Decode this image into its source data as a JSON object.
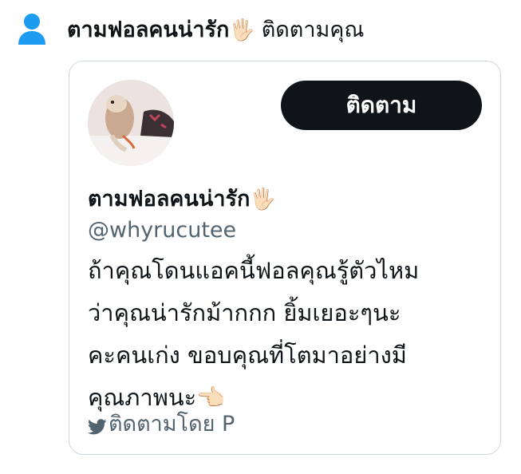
{
  "notification": {
    "name": "ตามฟอลคนน่ารัก",
    "hand_emoji": "🖐🏻",
    "action": "ติดตามคุณ"
  },
  "card": {
    "follow_button": "ติดตาม",
    "display_name": "ตามฟอลคนน่ารัก",
    "display_name_emoji": "🖐🏻",
    "handle": "@whyrucutee",
    "bio_lines": [
      "ถ้าคุณโดนแอคนี้ฟอลคุณรู้ตัวไหม",
      "ว่าคุณน่ารักม้ากกก ยิ้มเยอะๆนะ",
      "คะคนเก่ง ขอบคุณที่โตมาอย่างมี",
      "คุณภาพนะ"
    ],
    "bio_end_emoji": "👈🏻",
    "followed_by": "ติดตามโดย P"
  },
  "colors": {
    "accent": "#1d9bf0",
    "button_bg": "#0f1419",
    "muted_text": "#536471",
    "border": "#cfd9de"
  }
}
